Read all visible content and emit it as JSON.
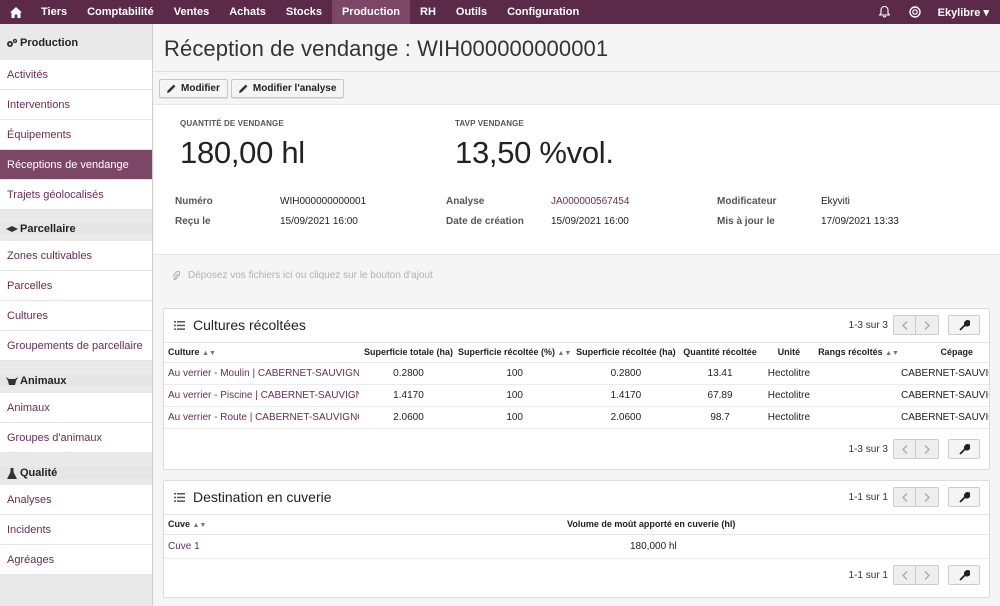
{
  "nav": {
    "items": [
      "Tiers",
      "Comptabilité",
      "Ventes",
      "Achats",
      "Stocks",
      "Production",
      "RH",
      "Outils",
      "Configuration"
    ],
    "active": "Production",
    "user": "Ekylibre"
  },
  "sidebar": {
    "sections": [
      {
        "title": "Production",
        "icon": "gears-icon",
        "items": [
          "Activités",
          "Interventions",
          "Équipements",
          "Réceptions de vendange",
          "Trajets géolocalisés"
        ]
      },
      {
        "title": "Parcellaire",
        "icon": "map-layers-icon",
        "items": [
          "Zones cultivables",
          "Parcelles",
          "Cultures",
          "Groupements de parcellaire"
        ]
      },
      {
        "title": "Animaux",
        "icon": "cow-icon",
        "items": [
          "Animaux",
          "Groupes d'animaux"
        ]
      },
      {
        "title": "Qualité",
        "icon": "flask-icon",
        "items": [
          "Analyses",
          "Incidents",
          "Agréages"
        ]
      }
    ],
    "active_item": "Réceptions de vendange"
  },
  "page": {
    "title": "Réception de vendange : WIH000000000001",
    "buttons": [
      "Modifier",
      "Modifier l'analyse"
    ]
  },
  "kpis": [
    {
      "label": "Quantité de vendange",
      "value": "180,00 hl"
    },
    {
      "label": "TAVP vendange",
      "value": "13,50 %vol."
    }
  ],
  "details": {
    "numero": {
      "label": "Numéro",
      "value": "WIH000000000001"
    },
    "recu_le": {
      "label": "Reçu le",
      "value": "15/09/2021 16:00"
    },
    "analyse": {
      "label": "Analyse",
      "value": "JA000000567454"
    },
    "date_creation": {
      "label": "Date de création",
      "value": "15/09/2021 16:00"
    },
    "modificateur": {
      "label": "Modificateur",
      "value": "Ekyviti"
    },
    "mis_a_jour": {
      "label": "Mis à jour le",
      "value": "17/09/2021 13:33"
    }
  },
  "dropzone": "Déposez vos fichiers ici ou cliquez sur le bouton d'ajout",
  "cultures": {
    "title": "Cultures récoltées",
    "pagination": "1-3 sur 3",
    "columns": [
      "Culture",
      "Superficie totale (ha)",
      "Superficie récoltée (%)",
      "Superficie récoltée (ha)",
      "Quantité récoltée",
      "Unité",
      "Rangs récoltés",
      "Cépage"
    ],
    "rows": [
      [
        "Au verrier - Moulin | CABERNET-SAUVIGNO...",
        "0.2800",
        "100",
        "0.2800",
        "13.41",
        "Hectolitre",
        "",
        "CABERNET-SAUVIG"
      ],
      [
        "Au verrier - Piscine | CABERNET-SAUVIGN...",
        "1.4170",
        "100",
        "1.4170",
        "67.89",
        "Hectolitre",
        "",
        "CABERNET-SAUVIG"
      ],
      [
        "Au verrier - Route | CABERNET-SAUVIGNO...",
        "2.0600",
        "100",
        "2.0600",
        "98.7",
        "Hectolitre",
        "",
        "CABERNET-SAUVIG"
      ]
    ]
  },
  "cuverie": {
    "title": "Destination en cuverie",
    "pagination": "1-1 sur 1",
    "columns": [
      "Cuve",
      "Volume de moût apporté en cuverie (hl)"
    ],
    "rows": [
      [
        "Cuve 1",
        "180,000 hl"
      ]
    ]
  },
  "colors": {
    "brand": "#5c2a49",
    "active": "#7c4766",
    "link": "#6a2c55"
  }
}
